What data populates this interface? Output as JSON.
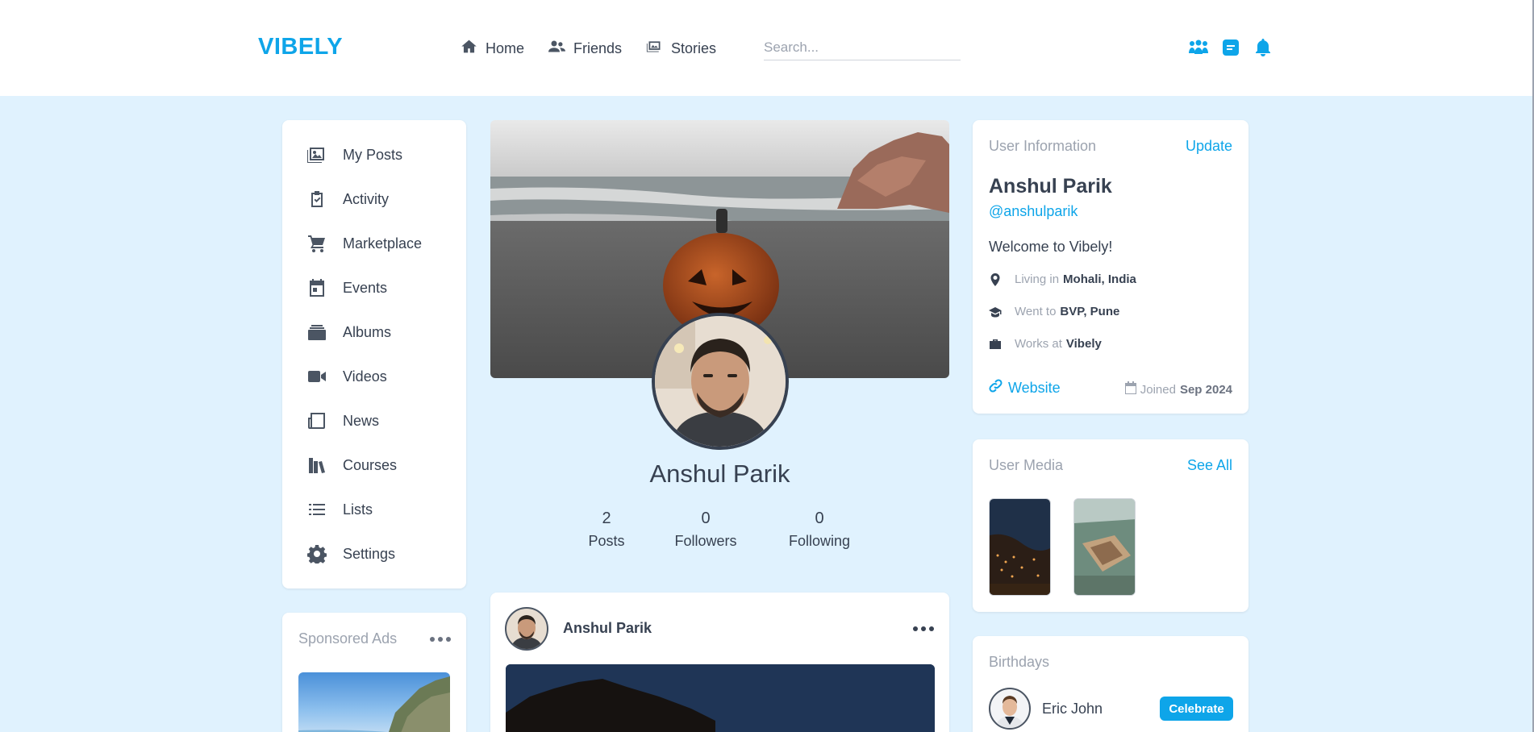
{
  "brand": {
    "logo": "VIBELY",
    "accent": "#0ea5e9"
  },
  "nav": {
    "items": [
      {
        "label": "Home",
        "icon": "home-icon"
      },
      {
        "label": "Friends",
        "icon": "friends-icon"
      },
      {
        "label": "Stories",
        "icon": "stories-icon"
      }
    ],
    "search_placeholder": "Search...",
    "right_icons": [
      "groups-icon",
      "messages-icon",
      "bell-icon"
    ]
  },
  "sidebar": {
    "items": [
      {
        "label": "My Posts",
        "icon": "photos-icon"
      },
      {
        "label": "Activity",
        "icon": "clipboard-check-icon"
      },
      {
        "label": "Marketplace",
        "icon": "cart-icon"
      },
      {
        "label": "Events",
        "icon": "calendar-icon"
      },
      {
        "label": "Albums",
        "icon": "albums-icon"
      },
      {
        "label": "Videos",
        "icon": "video-icon"
      },
      {
        "label": "News",
        "icon": "newspaper-icon"
      },
      {
        "label": "Courses",
        "icon": "books-icon"
      },
      {
        "label": "Lists",
        "icon": "list-icon"
      },
      {
        "label": "Settings",
        "icon": "gear-icon"
      }
    ]
  },
  "ads": {
    "title": "Sponsored Ads"
  },
  "profile": {
    "name": "Anshul Parik",
    "stats": [
      {
        "value": "2",
        "label": "Posts"
      },
      {
        "value": "0",
        "label": "Followers"
      },
      {
        "value": "0",
        "label": "Following"
      }
    ]
  },
  "post": {
    "author": "Anshul Parik"
  },
  "user_info": {
    "title": "User Information",
    "update_label": "Update",
    "name": "Anshul Parik",
    "handle": "@anshulparik",
    "bio": "Welcome to Vibely!",
    "living_label": "Living in",
    "living_value": "Mohali, India",
    "went_label": "Went to",
    "went_value": "BVP, Pune",
    "works_label": "Works at",
    "works_value": "Vibely",
    "website_label": "Website",
    "joined_label": "Joined",
    "joined_value": "Sep 2024"
  },
  "user_media": {
    "title": "User Media",
    "see_all": "See All"
  },
  "birthdays": {
    "title": "Birthdays",
    "name": "Eric John",
    "button": "Celebrate"
  }
}
